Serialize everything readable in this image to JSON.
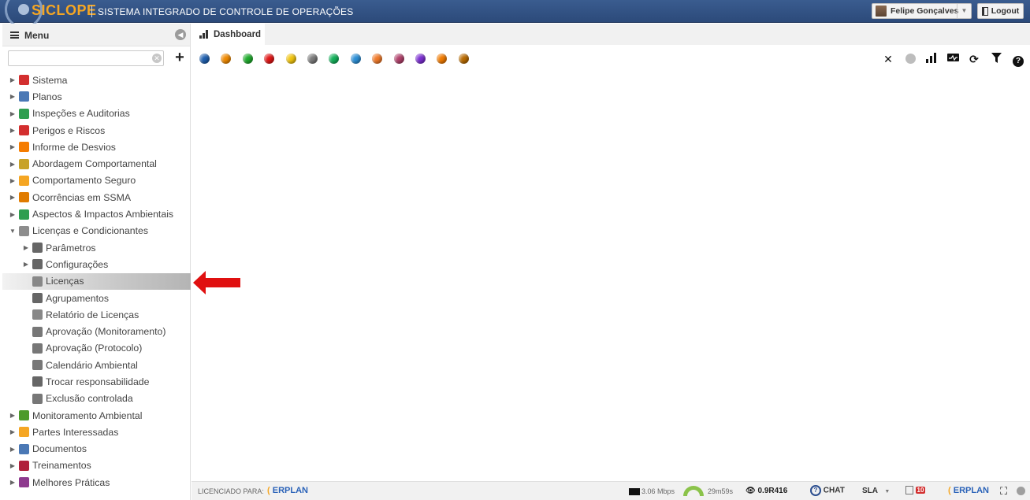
{
  "header": {
    "logo_text": "SICLOPE",
    "system_title": "SISTEMA INTEGRADO DE CONTROLE DE OPERAÇÕES",
    "user_name": "Felipe Gonçalves",
    "logout_label": "Logout"
  },
  "sidebar": {
    "title": "Menu",
    "search_placeholder": "",
    "items": [
      {
        "label": "Sistema",
        "icon": "gear-red-icon",
        "color": "#d32f2f"
      },
      {
        "label": "Planos",
        "icon": "calendar-icon",
        "color": "#4a78b5"
      },
      {
        "label": "Inspeções e Auditorias",
        "icon": "clipboard-check-icon",
        "color": "#2e9e4f"
      },
      {
        "label": "Perigos e Riscos",
        "icon": "warning-icon",
        "color": "#d32f2f"
      },
      {
        "label": "Informe de Desvios",
        "icon": "phone-icon",
        "color": "#f57c00"
      },
      {
        "label": "Abordagem Comportamental",
        "icon": "diamond-sign-icon",
        "color": "#c8a227"
      },
      {
        "label": "Comportamento Seguro",
        "icon": "hardhat-icon",
        "color": "#f5a623"
      },
      {
        "label": "Ocorrências em SSMA",
        "icon": "falling-person-icon",
        "color": "#e07b00"
      },
      {
        "label": "Aspectos & Impactos Ambientais",
        "icon": "recycle-icon",
        "color": "#2e9e4f"
      },
      {
        "label": "Licenças e Condicionantes",
        "icon": "folder-open-icon",
        "color": "#8d8d8d"
      }
    ],
    "sub_items": [
      {
        "label": "Parâmetros",
        "icon": "gear-icon",
        "color": "#666666",
        "has_children": true
      },
      {
        "label": "Configurações",
        "icon": "sliders-icon",
        "color": "#666666",
        "has_children": true
      },
      {
        "label": "Licenças",
        "icon": "certificate-icon",
        "color": "#888888",
        "has_children": false
      },
      {
        "label": "Agrupamentos",
        "icon": "hierarchy-icon",
        "color": "#666666",
        "has_children": false
      },
      {
        "label": "Relatório de Licenças",
        "icon": "pdf-icon",
        "color": "#888888",
        "has_children": false
      },
      {
        "label": "Aprovação (Monitoramento)",
        "icon": "thumbs-up-icon",
        "color": "#777777",
        "has_children": false
      },
      {
        "label": "Aprovação (Protocolo)",
        "icon": "thumbs-up-icon",
        "color": "#777777",
        "has_children": false
      },
      {
        "label": "Calendário Ambiental",
        "icon": "calendar-gear-icon",
        "color": "#777777",
        "has_children": false
      },
      {
        "label": "Trocar responsabilidade",
        "icon": "user-swap-icon",
        "color": "#666666",
        "has_children": false
      },
      {
        "label": "Exclusão controlada",
        "icon": "trash-icon",
        "color": "#777777",
        "has_children": false
      }
    ],
    "bottom_items": [
      {
        "label": "Monitoramento Ambiental",
        "icon": "tree-icon",
        "color": "#4c9a2a"
      },
      {
        "label": "Partes Interessadas",
        "icon": "people-icon",
        "color": "#f5a623"
      },
      {
        "label": "Documentos",
        "icon": "documents-icon",
        "color": "#4a78b5"
      },
      {
        "label": "Treinamentos",
        "icon": "trainer-icon",
        "color": "#b0203c"
      },
      {
        "label": "Melhores Práticas",
        "icon": "award-icon",
        "color": "#8e3a8e"
      }
    ]
  },
  "main": {
    "tab_label": "Dashboard",
    "color_dots": [
      "#1f5fae",
      "#f08a00",
      "#1faa2c",
      "#e01616",
      "#f1c40f",
      "#7a7a7a",
      "#13b05a",
      "#2c8fd6",
      "#f07a2a",
      "#b0406a",
      "#7b2fd0",
      "#f07a00",
      "#b86a00"
    ],
    "tools": [
      "close-icon",
      "circle-icon",
      "signal-icon",
      "monitor-icon",
      "refresh-icon",
      "filter-icon",
      "help-icon"
    ]
  },
  "statusbar": {
    "licensed_label": "LICENCIADO PARA:",
    "brand_left": "ERPLAN",
    "speed": "3.06 Mbps",
    "session_time": "29m59s",
    "version": "0.9R416",
    "chat_label": "CHAT",
    "sla_label": "SLA",
    "badge_count": "10",
    "brand_right": "ERPLAN"
  }
}
